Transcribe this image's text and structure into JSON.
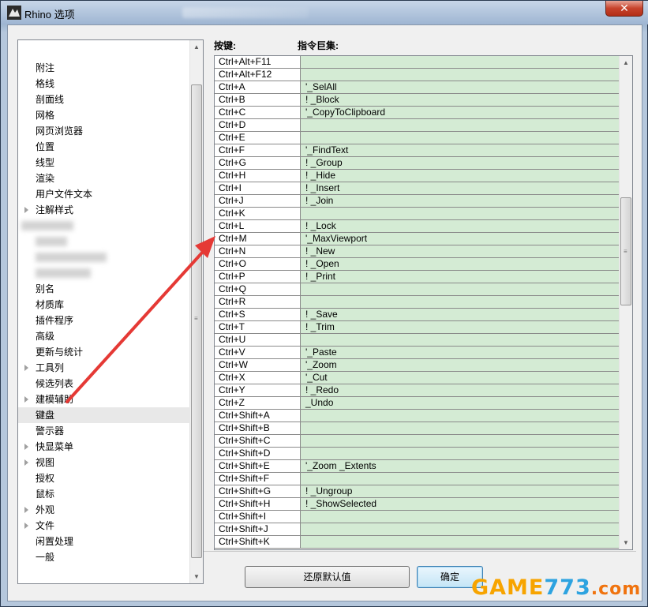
{
  "window": {
    "title": "Rhino 选项",
    "close_label": "✕"
  },
  "tree": {
    "items": [
      {
        "label": "附注",
        "expandable": false
      },
      {
        "label": "格线",
        "expandable": false
      },
      {
        "label": "剖面线",
        "expandable": false
      },
      {
        "label": "网格",
        "expandable": false
      },
      {
        "label": "网页浏览器",
        "expandable": false
      },
      {
        "label": "位置",
        "expandable": false
      },
      {
        "label": "线型",
        "expandable": false
      },
      {
        "label": "渲染",
        "expandable": false
      },
      {
        "label": "用户文件文本",
        "expandable": false
      },
      {
        "label": "注解样式",
        "expandable": true
      },
      {
        "label": "",
        "expandable": false
      },
      {
        "label": "",
        "expandable": false
      },
      {
        "label": "",
        "expandable": false
      },
      {
        "label": "",
        "expandable": false
      },
      {
        "label": "别名",
        "expandable": false
      },
      {
        "label": "材质库",
        "expandable": false
      },
      {
        "label": "插件程序",
        "expandable": false
      },
      {
        "label": "高级",
        "expandable": false
      },
      {
        "label": "更新与统计",
        "expandable": false
      },
      {
        "label": "工具列",
        "expandable": true
      },
      {
        "label": "候选列表",
        "expandable": false
      },
      {
        "label": "建模辅助",
        "expandable": true
      },
      {
        "label": "键盘",
        "expandable": false,
        "selected": true
      },
      {
        "label": "警示器",
        "expandable": false
      },
      {
        "label": "快显菜单",
        "expandable": true
      },
      {
        "label": "视图",
        "expandable": true
      },
      {
        "label": "授权",
        "expandable": false
      },
      {
        "label": "鼠标",
        "expandable": false
      },
      {
        "label": "外观",
        "expandable": true
      },
      {
        "label": "文件",
        "expandable": true
      },
      {
        "label": "闲置处理",
        "expandable": false
      },
      {
        "label": "一般",
        "expandable": false
      }
    ]
  },
  "keyboard": {
    "header_key": "按键:",
    "header_macro": "指令巨集:",
    "rows": [
      {
        "key": "Ctrl+Alt+F11",
        "macro": ""
      },
      {
        "key": "Ctrl+Alt+F12",
        "macro": ""
      },
      {
        "key": "Ctrl+A",
        "macro": "'_SelAll"
      },
      {
        "key": "Ctrl+B",
        "macro": "! _Block"
      },
      {
        "key": "Ctrl+C",
        "macro": "'_CopyToClipboard"
      },
      {
        "key": "Ctrl+D",
        "macro": ""
      },
      {
        "key": "Ctrl+E",
        "macro": ""
      },
      {
        "key": "Ctrl+F",
        "macro": "'_FindText"
      },
      {
        "key": "Ctrl+G",
        "macro": "! _Group"
      },
      {
        "key": "Ctrl+H",
        "macro": "! _Hide"
      },
      {
        "key": "Ctrl+I",
        "macro": "! _Insert"
      },
      {
        "key": "Ctrl+J",
        "macro": "! _Join"
      },
      {
        "key": "Ctrl+K",
        "macro": ""
      },
      {
        "key": "Ctrl+L",
        "macro": "! _Lock"
      },
      {
        "key": "Ctrl+M",
        "macro": "'_MaxViewport"
      },
      {
        "key": "Ctrl+N",
        "macro": "! _New"
      },
      {
        "key": "Ctrl+O",
        "macro": "! _Open"
      },
      {
        "key": "Ctrl+P",
        "macro": "! _Print"
      },
      {
        "key": "Ctrl+Q",
        "macro": ""
      },
      {
        "key": "Ctrl+R",
        "macro": ""
      },
      {
        "key": "Ctrl+S",
        "macro": "! _Save"
      },
      {
        "key": "Ctrl+T",
        "macro": "! _Trim"
      },
      {
        "key": "Ctrl+U",
        "macro": ""
      },
      {
        "key": "Ctrl+V",
        "macro": "'_Paste"
      },
      {
        "key": "Ctrl+W",
        "macro": "'_Zoom"
      },
      {
        "key": "Ctrl+X",
        "macro": "'_Cut"
      },
      {
        "key": "Ctrl+Y",
        "macro": "! _Redo"
      },
      {
        "key": "Ctrl+Z",
        "macro": "_Undo"
      },
      {
        "key": "Ctrl+Shift+A",
        "macro": ""
      },
      {
        "key": "Ctrl+Shift+B",
        "macro": ""
      },
      {
        "key": "Ctrl+Shift+C",
        "macro": ""
      },
      {
        "key": "Ctrl+Shift+D",
        "macro": ""
      },
      {
        "key": "Ctrl+Shift+E",
        "macro": "'_Zoom _Extents"
      },
      {
        "key": "Ctrl+Shift+F",
        "macro": ""
      },
      {
        "key": "Ctrl+Shift+G",
        "macro": "! _Ungroup"
      },
      {
        "key": "Ctrl+Shift+H",
        "macro": "! _ShowSelected"
      },
      {
        "key": "Ctrl+Shift+I",
        "macro": ""
      },
      {
        "key": "Ctrl+Shift+J",
        "macro": ""
      },
      {
        "key": "Ctrl+Shift+K",
        "macro": ""
      }
    ]
  },
  "buttons": {
    "restore_defaults": "还原默认值",
    "ok": "确定"
  },
  "watermark": {
    "part1": "GAME",
    "part2": "773",
    "part3": ".com"
  },
  "colors": {
    "macro_cell_bg": "#d4ebd4",
    "arrow": "#e53935",
    "selected_row_bg": "#e8e8e8"
  }
}
